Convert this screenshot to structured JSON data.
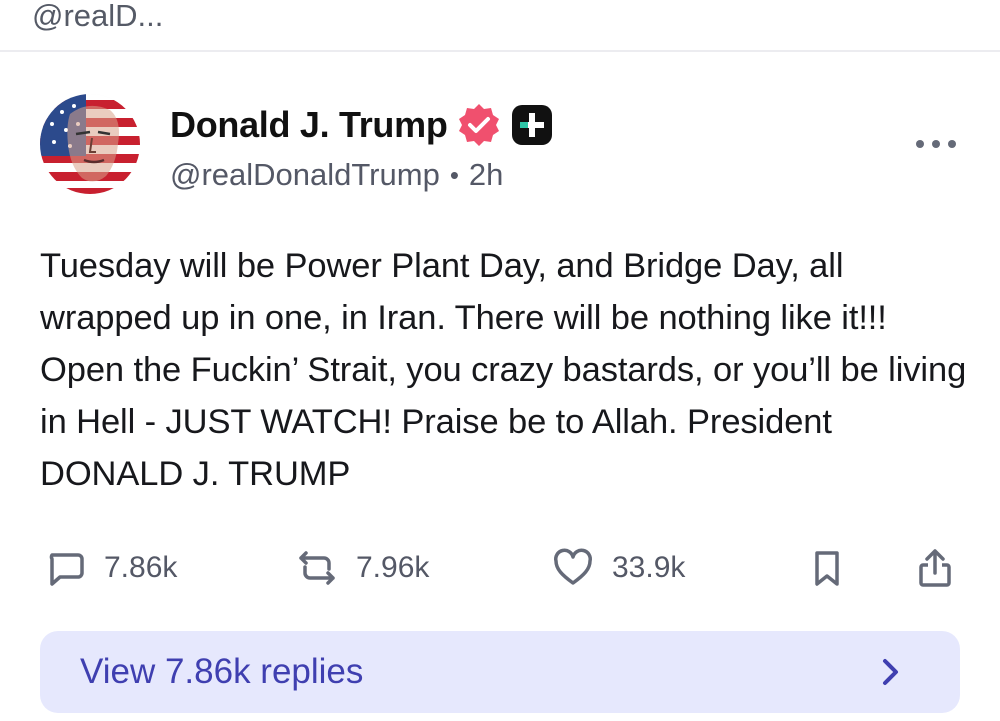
{
  "topbar": {
    "handle": "@realD..."
  },
  "post": {
    "author_name": "Donald J. Trump",
    "handle": "@realDonaldTrump",
    "separator": "•",
    "time": "2h",
    "body": "Tuesday will be Power Plant Day, and Bridge Day, all wrapped up in one, in Iran. There will be nothing like it!!! Open the Fuckin’ Strait, you crazy bastards, or you’ll be living in Hell - JUST WATCH! Praise be to Allah. President DONALD J. TRUMP"
  },
  "actions": {
    "replies": {
      "count": "7.86k",
      "icon": "comment-icon"
    },
    "reposts": {
      "count": "7.96k",
      "icon": "repost-icon"
    },
    "likes": {
      "count": "33.9k",
      "icon": "heart-icon"
    },
    "bookmark": {
      "icon": "bookmark-icon"
    },
    "share": {
      "icon": "share-icon"
    }
  },
  "replies_bar": {
    "label": "View 7.86k replies",
    "icon": "chevron-right-icon"
  },
  "colors": {
    "verified_badge": "#f0506e",
    "accent": "#3f3fb0",
    "replies_bg": "#e6e8fd",
    "muted_text": "#545866",
    "icon": "#656a78"
  }
}
